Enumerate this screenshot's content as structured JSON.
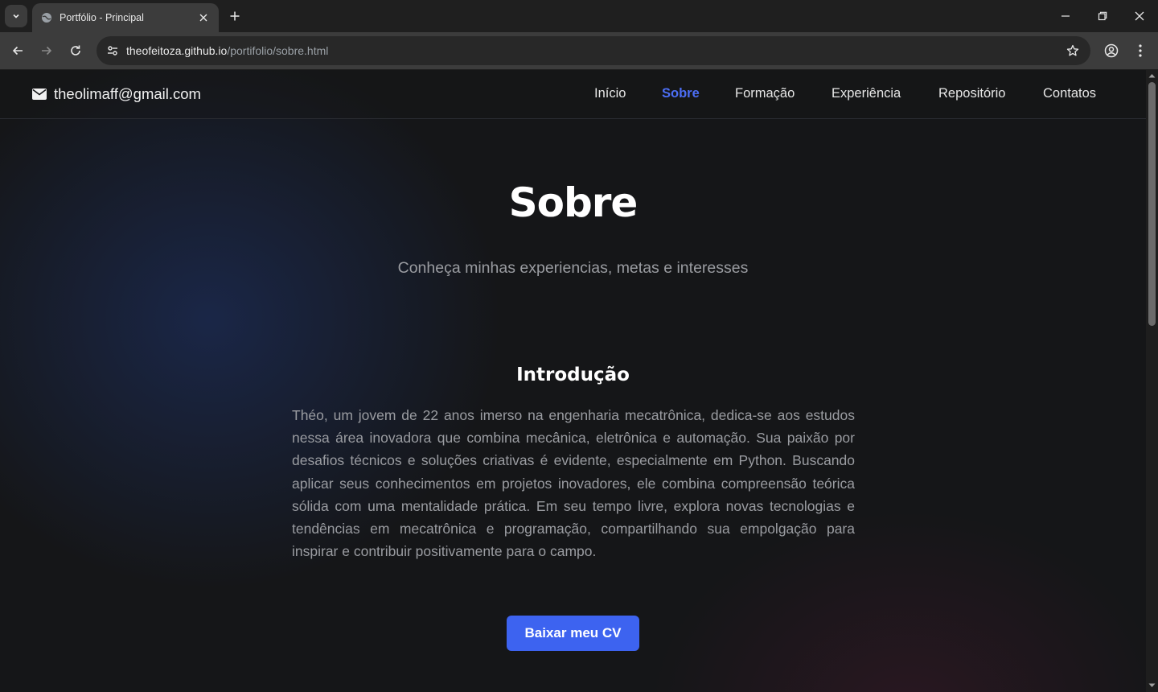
{
  "browser": {
    "tab_title": "Portfólio - Principal",
    "url_host": "theofeitoza.github.io",
    "url_path": "/portifolio/sobre.html"
  },
  "header": {
    "email": "theolimaff@gmail.com",
    "nav": [
      {
        "label": "Início",
        "active": false
      },
      {
        "label": "Sobre",
        "active": true
      },
      {
        "label": "Formação",
        "active": false
      },
      {
        "label": "Experiência",
        "active": false
      },
      {
        "label": "Repositório",
        "active": false
      },
      {
        "label": "Contatos",
        "active": false
      }
    ]
  },
  "main": {
    "title": "Sobre",
    "subtitle": "Conheça minhas experiencias, metas e interesses",
    "section_title": "Introdução",
    "intro": "Théo, um jovem de 22 anos imerso na engenharia mecatrônica, dedica-se aos estudos nessa área inovadora que combina mecânica, eletrônica e automação. Sua paixão por desafios técnicos e soluções criativas é evidente, especialmente em Python. Buscando aplicar seus conhecimentos em projetos inovadores, ele combina compreensão teórica sólida com uma mentalidade prática. Em seu tempo livre, explora novas tecnologias e tendências em mecatrônica e programação, compartilhando sua empolgação para inspirar e contribuir positivamente para o campo.",
    "cv_button": "Baixar meu CV"
  },
  "colors": {
    "accent": "#4c6ef5",
    "button": "#3d63f0",
    "background": "#151618"
  }
}
